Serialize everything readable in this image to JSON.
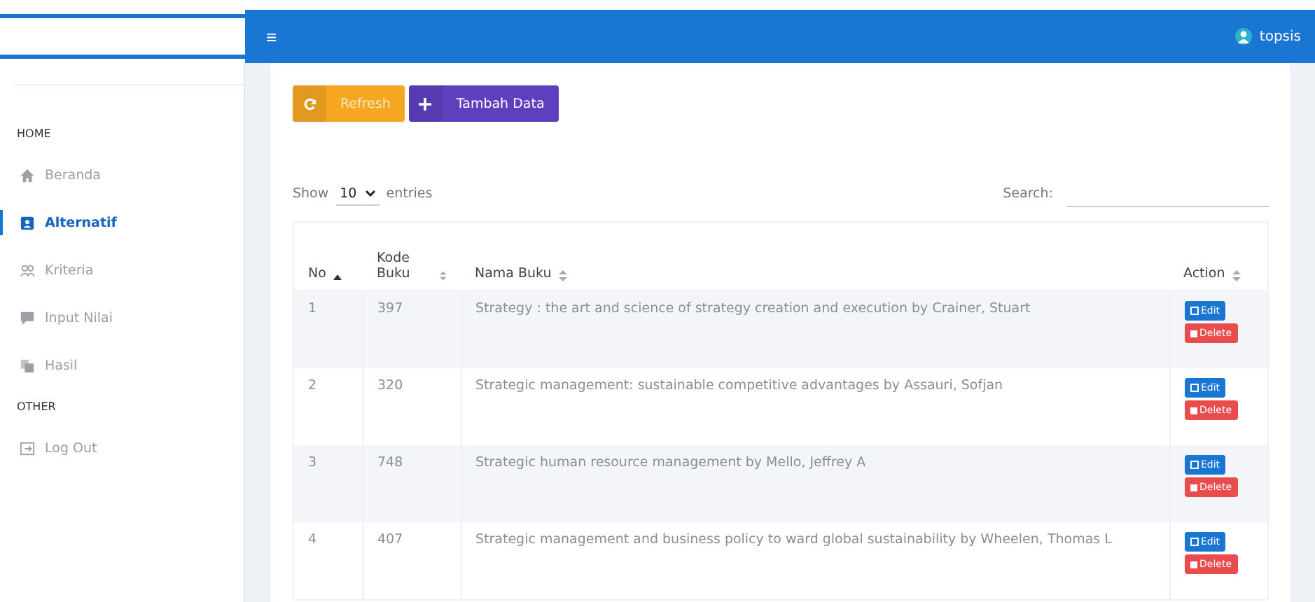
{
  "topbar": {
    "menu_glyph": "≡",
    "user": "topsis"
  },
  "sidebar": {
    "sections": [
      {
        "heading": "HOME",
        "items": [
          {
            "label": "Beranda",
            "selected": false
          },
          {
            "label": "Alternatif",
            "selected": true
          },
          {
            "label": "Kriteria",
            "selected": false
          },
          {
            "label": "Input Nilai",
            "selected": false
          },
          {
            "label": "Hasil",
            "selected": false
          }
        ]
      },
      {
        "heading": "OTHER",
        "items": [
          {
            "label": "Log Out",
            "selected": false
          }
        ]
      }
    ]
  },
  "toolbar": {
    "buttons": [
      {
        "label": "Refresh",
        "kind": "refresh"
      },
      {
        "label": "Tambah Data",
        "kind": "add"
      }
    ]
  },
  "length": {
    "before": "Show",
    "value": "10",
    "after": "entries"
  },
  "search": {
    "label": "Search:"
  },
  "table": {
    "columns": [
      {
        "label": "No",
        "selected": true
      },
      {
        "label": "Kode Buku",
        "selected": false
      },
      {
        "label": "Nama Buku",
        "selected": false
      },
      {
        "label": "Action",
        "selected": false
      }
    ],
    "rows": [
      {
        "no": "1",
        "kode": "397",
        "nama": "Strategy : the art and science of strategy creation and execution by Crainer, Stuart",
        "edit": "Edit",
        "delete": "Delete"
      },
      {
        "no": "2",
        "kode": "320",
        "nama": "Strategic management: sustainable competitive advantages by Assauri, Sofjan",
        "edit": "Edit",
        "delete": "Delete"
      },
      {
        "no": "3",
        "kode": "748",
        "nama": "Strategic human resource management by Mello, Jeffrey A",
        "edit": "Edit",
        "delete": "Delete"
      },
      {
        "no": "4",
        "kode": "407",
        "nama": "Strategic management and business policy to ward global sustainability by Wheelen, Thomas L",
        "edit": "Edit",
        "delete": "Delete"
      }
    ]
  }
}
